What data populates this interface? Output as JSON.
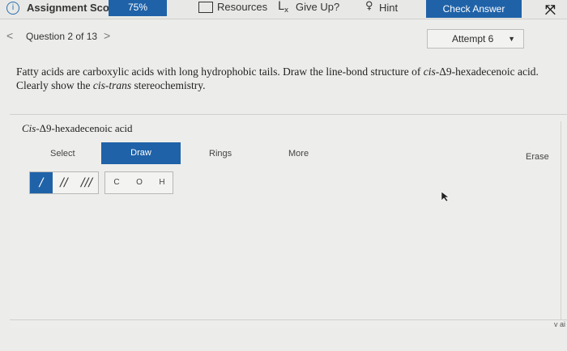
{
  "topbar": {
    "info_icon_glyph": "i",
    "score_label": "Assignment Score:",
    "score_value": "75%",
    "resources_label": "Resources",
    "giveup_label": "Give Up?",
    "hint_label": "Hint",
    "check_answer_label": "Check Answer"
  },
  "nav": {
    "prev_glyph": "<",
    "question_label": "Question 2 of 13",
    "next_glyph": ">",
    "attempt_label": "Attempt 6"
  },
  "question": {
    "line1_a": "Fatty acids are carboxylic acids with long hydrophobic tails. Draw the line-bond structure of ",
    "line1_b": "cis",
    "line1_c": "-Δ9-hexadecenoic acid.",
    "line2_a": "Clearly show the ",
    "line2_b": "cis-trans",
    "line2_c": " stereochemistry."
  },
  "panel": {
    "title_a": "Cis",
    "title_b": "-Δ9-hexadecenoic acid"
  },
  "toolbar": {
    "select_label": "Select",
    "draw_label": "Draw",
    "rings_label": "Rings",
    "more_label": "More",
    "erase_label": "Erase"
  },
  "bonds": {
    "single": "/",
    "double": "//",
    "triple": "///"
  },
  "atoms": {
    "c": "C",
    "o": "O",
    "h": "H"
  },
  "misc": {
    "right_clip_text": "v ai"
  },
  "colors": {
    "accent": "#1f62a8",
    "background": "#ececea"
  }
}
